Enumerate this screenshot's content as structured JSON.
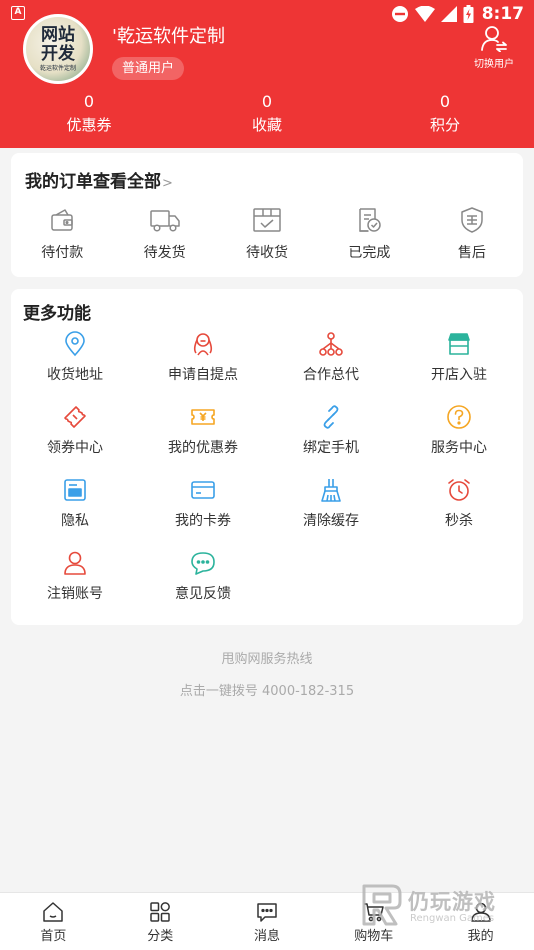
{
  "status_bar": {
    "time": "8:17",
    "app_indicator": "A"
  },
  "profile": {
    "avatar_text_line1": "网站",
    "avatar_text_line2": "开发",
    "avatar_text_small": "乾运软件定制",
    "username": "'乾运软件定制",
    "user_type": "普通用户",
    "switch_user_label": "切换用户"
  },
  "stats": [
    {
      "value": "0",
      "label": "优惠券"
    },
    {
      "value": "0",
      "label": "收藏"
    },
    {
      "value": "0",
      "label": "积分"
    }
  ],
  "orders": {
    "title": "我的订单查看全部",
    "arrow": ">",
    "items": [
      {
        "label": "待付款",
        "icon": "wallet-icon"
      },
      {
        "label": "待发货",
        "icon": "truck-icon"
      },
      {
        "label": "待收货",
        "icon": "package-icon"
      },
      {
        "label": "已完成",
        "icon": "completed-doc-icon"
      },
      {
        "label": "售后",
        "icon": "after-sale-shield-icon"
      }
    ]
  },
  "more": {
    "title": "更多功能",
    "items": [
      {
        "label": "收货地址",
        "icon": "location-pin-icon",
        "color": "#3a9fe8"
      },
      {
        "label": "申请自提点",
        "icon": "person-pickup-icon",
        "color": "#e64a3c"
      },
      {
        "label": "合作总代",
        "icon": "network-icon",
        "color": "#e64a3c"
      },
      {
        "label": "开店入驻",
        "icon": "store-icon",
        "color": "#2bb39c"
      },
      {
        "label": "领券中心",
        "icon": "ticket-icon",
        "color": "#e64a3c"
      },
      {
        "label": "我的优惠券",
        "icon": "coupon-yen-icon",
        "color": "#f5a623"
      },
      {
        "label": "绑定手机",
        "icon": "link-icon",
        "color": "#3a9fe8"
      },
      {
        "label": "服务中心",
        "icon": "question-icon",
        "color": "#f5a623"
      },
      {
        "label": "隐私",
        "icon": "privacy-card-icon",
        "color": "#3a9fe8"
      },
      {
        "label": "我的卡券",
        "icon": "card-icon",
        "color": "#3a9fe8"
      },
      {
        "label": "清除缓存",
        "icon": "broom-icon",
        "color": "#3a9fe8"
      },
      {
        "label": "秒杀",
        "icon": "alarm-clock-icon",
        "color": "#e64a3c"
      },
      {
        "label": "注销账号",
        "icon": "user-icon",
        "color": "#e64a3c"
      },
      {
        "label": "意见反馈",
        "icon": "chat-bubble-icon",
        "color": "#2bb39c"
      }
    ]
  },
  "hotline": {
    "title": "甩购网服务热线",
    "phone": "点击一键拨号 4000-182-315"
  },
  "tabbar": [
    {
      "label": "首页",
      "icon": "home-icon"
    },
    {
      "label": "分类",
      "icon": "category-icon"
    },
    {
      "label": "消息",
      "icon": "message-icon"
    },
    {
      "label": "购物车",
      "icon": "cart-icon"
    },
    {
      "label": "我的",
      "icon": "profile-icon"
    }
  ],
  "watermark": {
    "text": "仍玩游戏",
    "sub": "Rengwan Games"
  },
  "colors": {
    "brand_red": "#ee3535",
    "page_bg": "#f4f4f4"
  }
}
